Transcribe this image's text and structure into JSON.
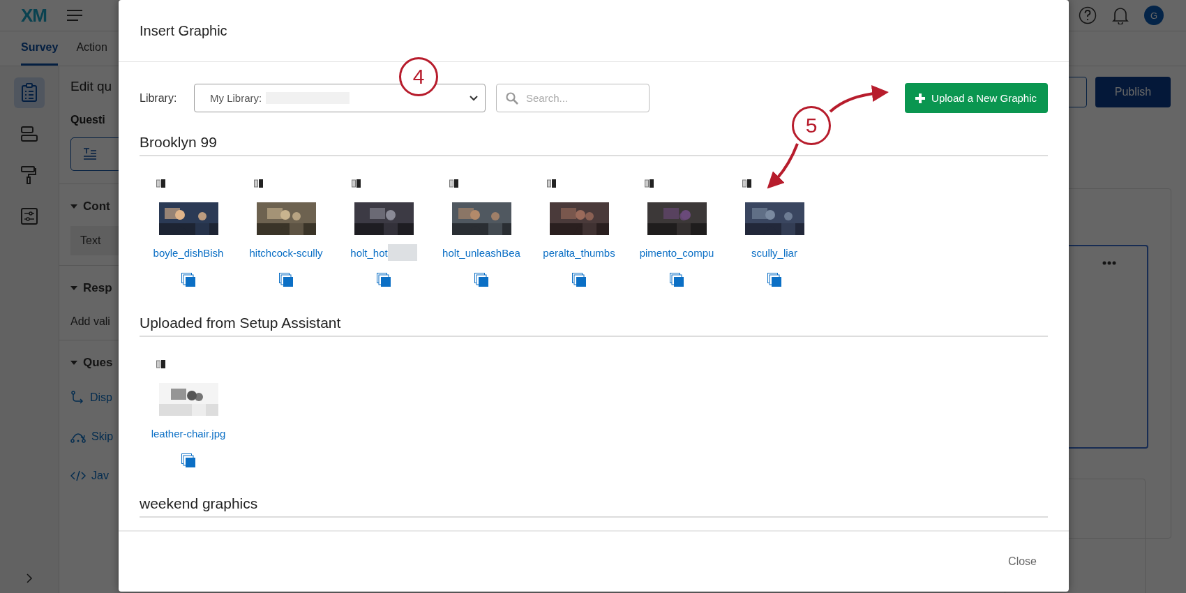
{
  "app": {
    "logo": "XM",
    "tabs": [
      {
        "label": "Survey",
        "selected": true
      },
      {
        "label": "Action",
        "selected": false
      }
    ],
    "rail": [
      {
        "kind": "survey",
        "selected": true
      },
      {
        "kind": "blocks",
        "selected": false
      },
      {
        "kind": "style",
        "selected": false
      },
      {
        "kind": "options",
        "selected": false
      }
    ],
    "editor": [
      {
        "kind": "title",
        "text": "Edit qu"
      },
      {
        "kind": "bold",
        "text": "Questi"
      },
      {
        "kind": "type-button"
      },
      {
        "kind": "section",
        "text": "Cont"
      },
      {
        "kind": "chip",
        "text": "Text"
      },
      {
        "kind": "section",
        "text": "Resp"
      },
      {
        "kind": "text",
        "text": "Add vali"
      },
      {
        "kind": "section",
        "text": "Ques"
      },
      {
        "kind": "branch",
        "text": "Disp"
      },
      {
        "kind": "skip",
        "text": "Skip"
      },
      {
        "kind": "code",
        "text": "Jav"
      }
    ],
    "publish": "Publish",
    "avatar": "G"
  },
  "dialog": {
    "title": "Insert Graphic",
    "library_label": "Library:",
    "library_value": "My Library:",
    "search_placeholder": "Search...",
    "upload_button": "Upload a New Graphic",
    "sections": [
      {
        "title": "Brooklyn 99",
        "items": [
          {
            "name": "boyle_dishBish",
            "redacted": false
          },
          {
            "name": "hitchcock-scully",
            "redacted": false
          },
          {
            "name": "holt_hot",
            "redacted": true
          },
          {
            "name": "holt_unleashBea",
            "redacted": false
          },
          {
            "name": "peralta_thumbs",
            "redacted": false
          },
          {
            "name": "pimento_compu",
            "redacted": false
          },
          {
            "name": "scully_liar",
            "redacted": false
          }
        ]
      },
      {
        "title": "Uploaded from Setup Assistant",
        "items": [
          {
            "name": "leather-chair.jpg",
            "redacted": false
          }
        ]
      },
      {
        "title": "weekend graphics"
      }
    ],
    "close": "Close"
  },
  "annotations": [
    {
      "number": "4"
    },
    {
      "number": "5"
    }
  ]
}
